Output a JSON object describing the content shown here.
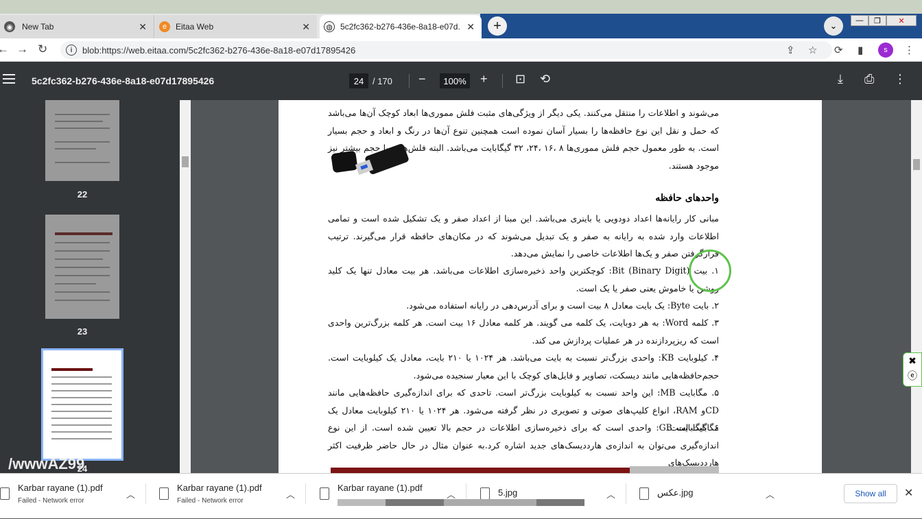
{
  "tabs": [
    {
      "title": "New Tab",
      "icon": "chrome-icon"
    },
    {
      "title": "Eitaa Web",
      "icon": "eitaa-icon"
    },
    {
      "title": "5c2fc362-b276-436e-8a18-e07d...",
      "icon": "globe-icon"
    }
  ],
  "address": {
    "url": "blob:https://web.eitaa.com/5c2fc362-b276-436e-8a18-e07d17895426"
  },
  "profile": {
    "initial": "s",
    "color": "#9b2bd1"
  },
  "pdf": {
    "doc_title": "5c2fc362-b276-436e-8a18-e07d17895426",
    "current_page": "24",
    "total_pages": "/ 170",
    "zoom": "100%"
  },
  "thumbnails": [
    {
      "label": "22"
    },
    {
      "label": "23"
    },
    {
      "label": "24"
    }
  ],
  "watermark": "/wwwAZ99",
  "content": {
    "para1": "می‌شوند و اطلاعات را منتقل می‌کنند. یکی دیگر از ویژگی‌های مثبت فلش مموری‌ها ابعاد کوچک آن‌ها می‌باشد که حمل و نقل این نوع حافظه‌ها را بسیار آسان نموده است همچنین تنوع آن‌ها در رنگ و ابعاد و حجم بسیار است. به طور معمول حجم فلش مموری‌ها ۸ ،۱۶ ،۲۴، ۳۲ گیگابایت می‌باشد. البته فلش‌هایی با حجم بیشتر نیز موجود هستند.",
    "heading": "واحدهای حافظه",
    "para2": "مبانی کار رایانه‌ها اعداد دودویی یا باینری می‌باشد. این مبنا از اعداد صفر و یک تشکیل شده است و تمامی اطلاعات وارد شده به رایانه به صفر و یک تبدیل می‌شوند که در مکان‌های حافظه قرار می‌گیرند. ترتیب قرارگرفتن صفر و یک‌ها اطلاعات خاصی را نمایش می‌دهد.",
    "item1": "۱. بیت (Binary Digit) Bit: کوچکترین واحد ذخیره‌سازی اطلاعات می‌باشد. هر بیت معادل تنها یک کلید روشن یا خاموش یعنی صفر یا یک است.",
    "item2": "۲. بایت Byte: یک بایت معادل ۸ بیت است و برای آدرس‌دهی در رایانه استفاده می‌شود.",
    "item3": "۳. کلمه Word: به هر دوبایت، یک کلمه می گویند. هر کلمه معادل ۱۶ بیت است. هر کلمه بزرگ‌ترین واحدی است که ریزپردازنده در هر عملیات پردازش می کند.",
    "item4": "۴. کیلوبایت KB: واحدی بزرگ‌تر نسبت به بایت می‌باشد. هر ۱۰۲۴ یا ۲۱۰ بایت، معادل یک کیلوبایت است. حجم‌حافظه‌هایی مانند دیسکت، تصاویر و فایل‌های کوچک با این معیار سنجیده می‌شود.",
    "item5": "۵. مگابایت MB: این واحد نسبت به کیلوبایت بزرگ‌تر است. تاحدی که برای اندازه‌گیری حافظه‌هایی مانند CDو RAM، انواع کلیپ‌های صوتی و تصویری در نظر گرفته می‌شود. هر ۱۰۲۴ یا ۲۱۰ کیلوبایت معادل یک مگابایت است.",
    "item6": "۶. گیگابایت GB: واحدی است که برای ذخیره‌سازی اطلاعات در حجم بالا تعیین شده است. از این نوع اندازه‌گیری می‌توان به اندازه‌ی هارددیسک‌های جدید اشاره کرد.به عنوان مثال در حال حاضر ظرفیت اکثر هارددیسک‌های"
  },
  "downloads": [
    {
      "name": "Karbar rayane (1).pdf",
      "status": "Failed - Network error"
    },
    {
      "name": "Karbar rayane (1).pdf",
      "status": "Failed - Network error"
    },
    {
      "name": "Karbar rayane (1).pdf",
      "status": ""
    },
    {
      "name": "5.jpg",
      "status": ""
    },
    {
      "name": "عکس.jpg",
      "status": ""
    }
  ],
  "show_all_label": "Show all"
}
